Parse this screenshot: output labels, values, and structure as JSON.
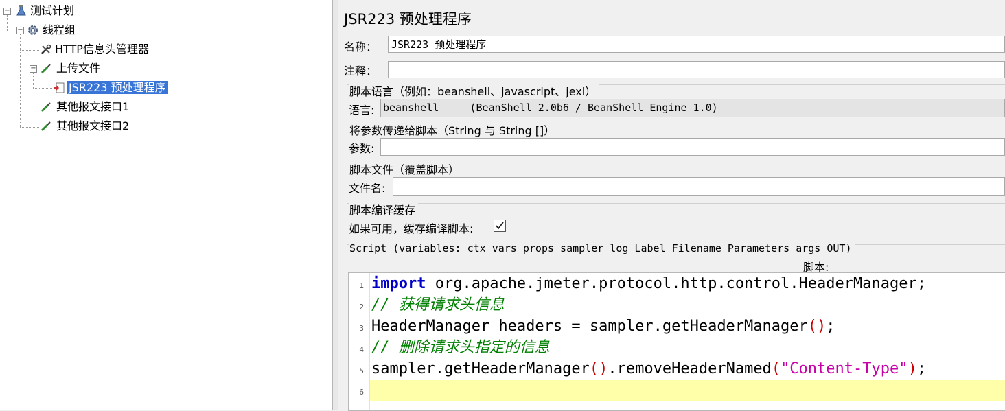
{
  "tree": {
    "nodes": [
      {
        "label": "测试计划",
        "icon": "flask-icon"
      },
      {
        "label": "线程组",
        "icon": "gear-icon"
      },
      {
        "label": "HTTP信息头管理器",
        "icon": "wrench-icon"
      },
      {
        "label": "上传文件",
        "icon": "pipette-icon"
      },
      {
        "label": "JSR223 预处理程序",
        "icon": "script-icon",
        "selected": true
      },
      {
        "label": "其他报文接口1",
        "icon": "pipette-icon"
      },
      {
        "label": "其他报文接口2",
        "icon": "pipette-icon"
      }
    ]
  },
  "panel": {
    "title": "JSR223 预处理程序",
    "name_label": "名称：",
    "name_value": "JSR223 预处理程序",
    "comment_label": "注释：",
    "comment_value": "",
    "lang_group_title": "脚本语言（例如：beanshell、javascript、jexl）",
    "lang_label": "语言:",
    "lang_value": "beanshell     (BeanShell 2.0b6 / BeanShell Engine 1.0)",
    "params_group_title": "将参数传递给脚本（String 与 String []）",
    "params_label": "参数:",
    "params_value": "",
    "file_group_title": "脚本文件（覆盖脚本）",
    "file_label": "文件名:",
    "file_value": "",
    "cache_group_title": "脚本编译缓存",
    "cache_label": "如果可用，缓存编译脚本:",
    "cache_checked": true,
    "script_group_title": "Script (variables: ctx vars props sampler log Label Filename Parameters args OUT)",
    "script_label": "脚本:"
  },
  "editor": {
    "line_numbers": [
      "1",
      "2",
      "3",
      "4",
      "5",
      "6"
    ],
    "lines": [
      [
        {
          "t": "import",
          "c": "kw"
        },
        {
          "t": " org.apache.jmeter.protocol.http.control.HeaderManager;",
          "c": ""
        }
      ],
      [
        {
          "t": "// 获得请求头信息",
          "c": "cm"
        }
      ],
      [
        {
          "t": "HeaderManager headers = sampler.getHeaderManager",
          "c": ""
        },
        {
          "t": "()",
          "c": "pr"
        },
        {
          "t": ";",
          "c": ""
        }
      ],
      [
        {
          "t": "// 删除请求头指定的信息",
          "c": "cm"
        }
      ],
      [
        {
          "t": "sampler.getHeaderManager",
          "c": ""
        },
        {
          "t": "()",
          "c": "pr"
        },
        {
          "t": ".removeHeaderNamed",
          "c": ""
        },
        {
          "t": "(",
          "c": "pr"
        },
        {
          "t": "\"Content-Type\"",
          "c": "st"
        },
        {
          "t": ")",
          "c": "pr"
        },
        {
          "t": ";",
          "c": ""
        }
      ],
      []
    ],
    "current_line_color": "#ffffaa"
  }
}
